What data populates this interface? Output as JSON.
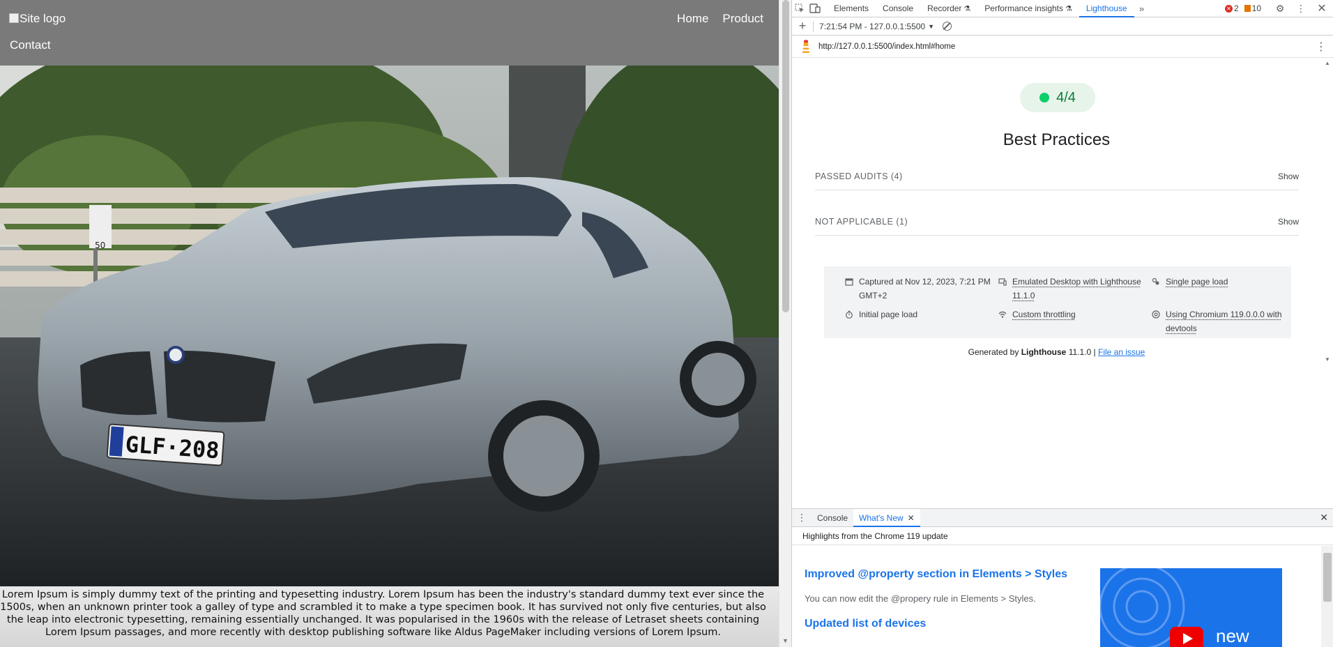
{
  "page": {
    "logo_alt": "Site logo",
    "nav": [
      {
        "label": "Home"
      },
      {
        "label": "Product"
      }
    ],
    "nav_contact": "Contact",
    "plate_text": "GLF·208",
    "sign_text": "50",
    "intro_text": "Lorem Ipsum is simply dummy text of the printing and typesetting industry. Lorem Ipsum has been the industry's standard dummy text ever since the 1500s, when an unknown printer took a galley of type and scrambled it to make a type specimen book. It has survived not only five centuries, but also the leap into electronic typesetting, remaining essentially unchanged. It was popularised in the 1960s with the release of Letraset sheets containing Lorem Ipsum passages, and more recently with desktop publishing software like Aldus PageMaker including versions of Lorem Ipsum."
  },
  "devtools": {
    "tabs": [
      {
        "label": "Elements"
      },
      {
        "label": "Console"
      },
      {
        "label": "Recorder"
      },
      {
        "label": "Performance insights"
      },
      {
        "label": "Lighthouse"
      }
    ],
    "error_count": "2",
    "warning_count": "10",
    "toolbar": {
      "report_label": "7:21:54 PM - 127.0.0.1:5500"
    },
    "url": "http://127.0.0.1:5500/index.html#home",
    "report": {
      "score": "4/4",
      "category_title": "Best Practices",
      "groups": [
        {
          "title": "PASSED AUDITS (4)",
          "action": "Show"
        },
        {
          "title": "NOT APPLICABLE (1)",
          "action": "Show"
        }
      ],
      "runtime": {
        "captured": "Captured at Nov 12, 2023, 7:21 PM GMT+2",
        "emulated": "Emulated Desktop with Lighthouse 11.1.0",
        "single_load": "Single page load",
        "initial_load": "Initial page load",
        "throttling": "Custom throttling",
        "chromium": "Using Chromium 119.0.0.0 with devtools"
      },
      "footer": {
        "prefix": "Generated by",
        "tool": "Lighthouse",
        "version": "11.1.0 |",
        "link": "File an issue"
      }
    },
    "drawer": {
      "tabs": [
        {
          "label": "Console"
        },
        {
          "label": "What's New"
        }
      ],
      "subtitle": "Highlights from the Chrome 119 update",
      "h1": "Improved @property section in Elements > Styles",
      "p1": "You can now edit the @propery rule in Elements > Styles.",
      "h2": "Updated list of devices",
      "video_badge": "new"
    }
  },
  "colors": {
    "accent": "#1a73e8",
    "pass": "#0cce6b",
    "error": "#d93025",
    "warning": "#e37400"
  }
}
